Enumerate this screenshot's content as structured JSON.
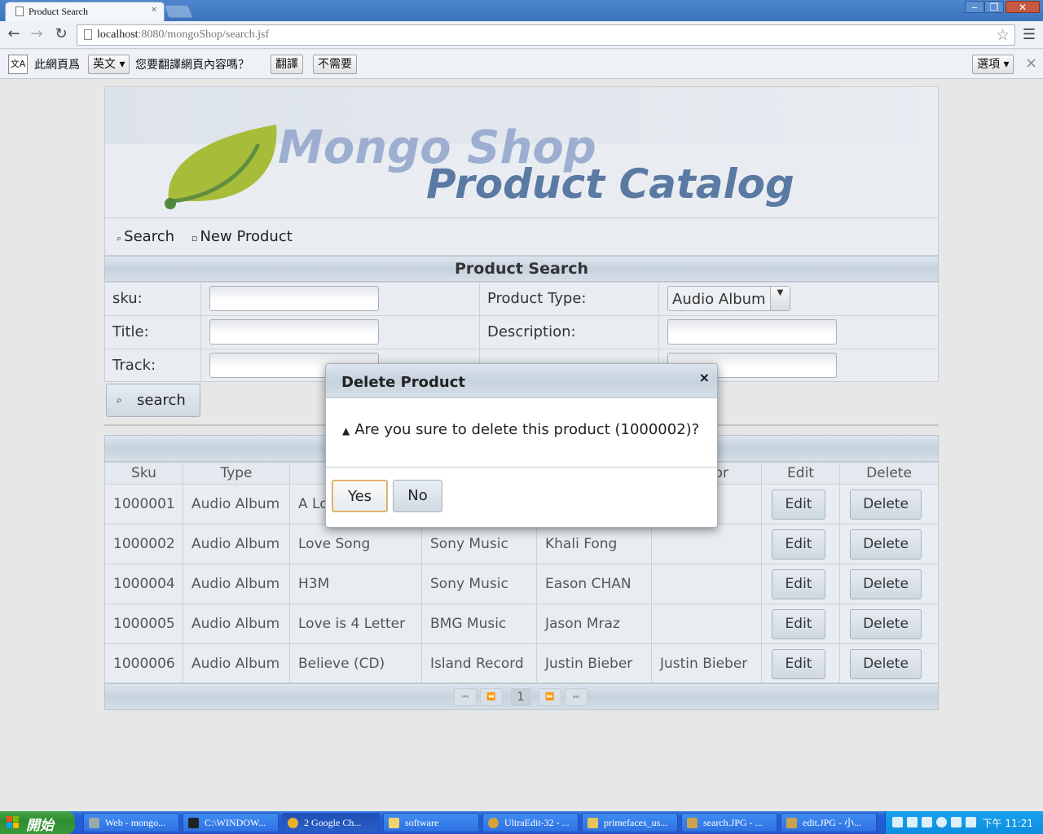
{
  "browser": {
    "tab_title": "Product Search",
    "tab_close": "×",
    "url_host": "localhost",
    "url_rest": ":8080/mongoShop/search.jsf",
    "window_buttons": [
      "‒",
      "❐",
      "✕"
    ]
  },
  "translate_bar": {
    "prefix": "此網頁爲",
    "language": "英文",
    "question": "您要翻譯網頁內容嗎？",
    "translate_button": "翻譯",
    "no_button": "不需要",
    "options_button": "選項",
    "close": "×"
  },
  "banner": {
    "title_line1": "Mongo Shop",
    "title_line2": "Product Catalog"
  },
  "nav": {
    "search": "Search",
    "new_product": "New Product"
  },
  "search_panel": {
    "header": "Product Search",
    "sku_label": "sku:",
    "product_type_label": "Product Type:",
    "product_type_value": "Audio Album",
    "title_label": "Title:",
    "description_label": "Description:",
    "track_label": "Track:",
    "search_button": "search"
  },
  "results": {
    "columns": [
      "Sku",
      "Type",
      "",
      "",
      "",
      "or",
      "Edit",
      "Delete"
    ],
    "rows": [
      [
        "1000001",
        "Audio Album",
        "A Lo",
        "",
        "",
        ""
      ],
      [
        "1000002",
        "Audio Album",
        "Love Song",
        "Sony Music",
        "Khali Fong",
        ""
      ],
      [
        "1000004",
        "Audio Album",
        "H3M",
        "Sony Music",
        "Eason CHAN",
        ""
      ],
      [
        "1000005",
        "Audio Album",
        "Love is 4 Letter",
        "BMG Music",
        "Jason Mraz",
        ""
      ],
      [
        "1000006",
        "Audio Album",
        "Believe (CD)",
        "Island Record",
        "Justin Bieber",
        "Justin Bieber"
      ]
    ],
    "edit_label": "Edit",
    "delete_label": "Delete",
    "paginator": {
      "first": "⏮",
      "prev": "⏪",
      "page": "1",
      "next": "⏩",
      "last": "⏭"
    }
  },
  "dialog": {
    "title": "Delete Product",
    "close": "×",
    "message": "Are you sure to delete this product (1000002)?",
    "yes": "Yes",
    "no": "No"
  },
  "taskbar": {
    "start": "開始",
    "tasks": [
      "Web - mongo...",
      "C:\\WINDOW...",
      "2 Google Ch...",
      "software",
      "UltraEdit-32 - ...",
      "primefaces_us...",
      "search.JPG - ...",
      "edit.JPG - 小..."
    ],
    "clock": "下午 11:21"
  }
}
